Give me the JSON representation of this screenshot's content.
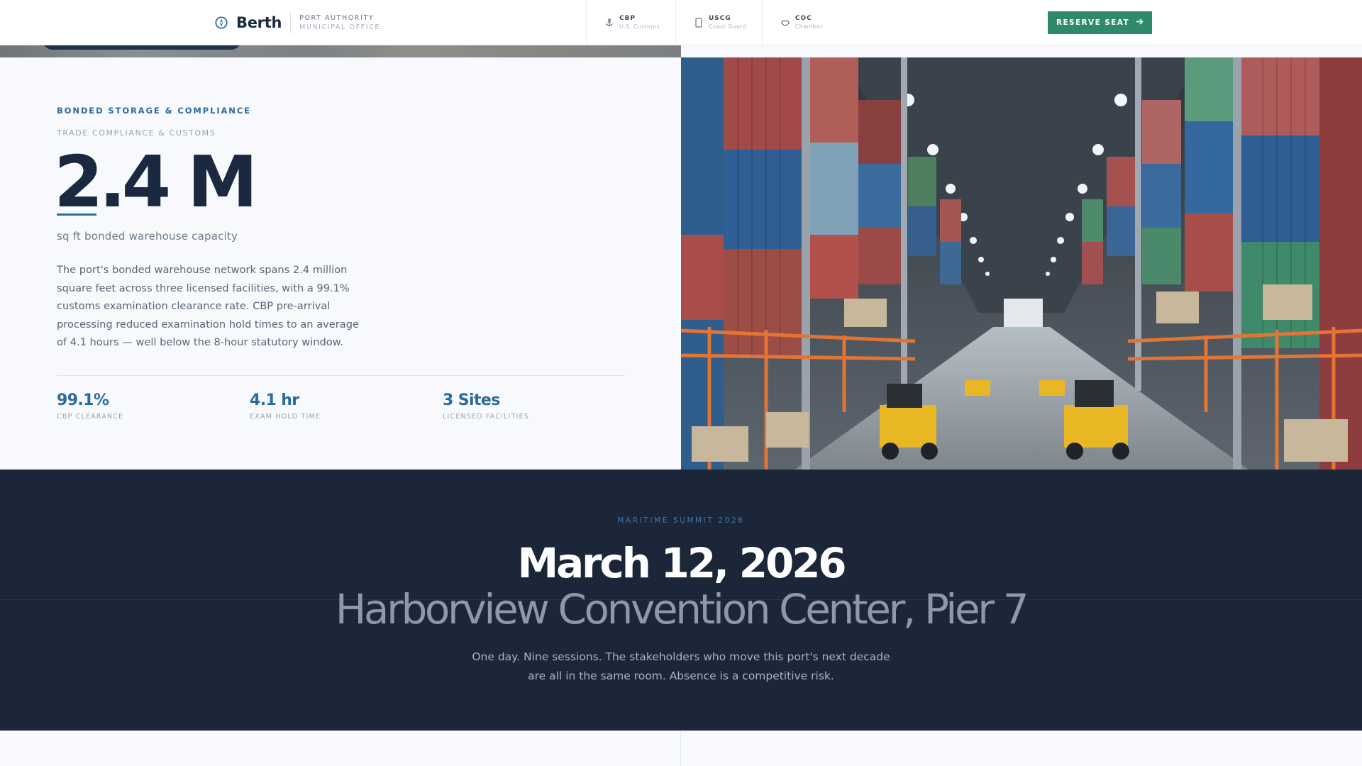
{
  "header": {
    "brand_name": "Berth",
    "brand_sub_1": "PORT AUTHORITY",
    "brand_sub_2": "MUNICIPAL OFFICE",
    "agencies": [
      {
        "code": "CBP",
        "name": "U.S. Customs",
        "icon": "anchor-icon"
      },
      {
        "code": "USCG",
        "name": "Coast Guard",
        "icon": "shield-icon"
      },
      {
        "code": "COC",
        "name": "Chamber",
        "icon": "handshake-icon"
      }
    ],
    "reserve_label": "RESERVE SEAT",
    "reserve_icon": "arrow-right-icon",
    "accent": "#2e8b6a"
  },
  "stat_section": {
    "eyebrow": "BONDED STORAGE & COMPLIANCE",
    "subeyebrow": "TRADE COMPLIANCE & CUSTOMS",
    "big_number": "2.4 M",
    "caption": "sq ft bonded warehouse capacity",
    "body": "The port's bonded warehouse network spans 2.4 million square feet across three licensed facilities, with a 99.1% customs examination clearance rate. CBP pre-arrival processing reduced examination hold times to an average of 4.1 hours — well below the 8-hour statutory window.",
    "stats": [
      {
        "value": "99.1%",
        "label": "CBP CLEARANCE"
      },
      {
        "value": "4.1 hr",
        "label": "EXAM HOLD TIME"
      },
      {
        "value": "3 Sites",
        "label": "LICENSED FACILITIES"
      }
    ],
    "accent": "#2d6c9e"
  },
  "event": {
    "eyebrow": "MARITIME SUMMIT 2026",
    "date": "March 12, 2026",
    "venue": "Harborview Convention Center, Pier 7",
    "copy_line1": "One day. Nine sessions. The stakeholders who move this port's next decade",
    "copy_line2": "are all in the same room. Absence is a competitive risk.",
    "background": "#1b2639"
  }
}
